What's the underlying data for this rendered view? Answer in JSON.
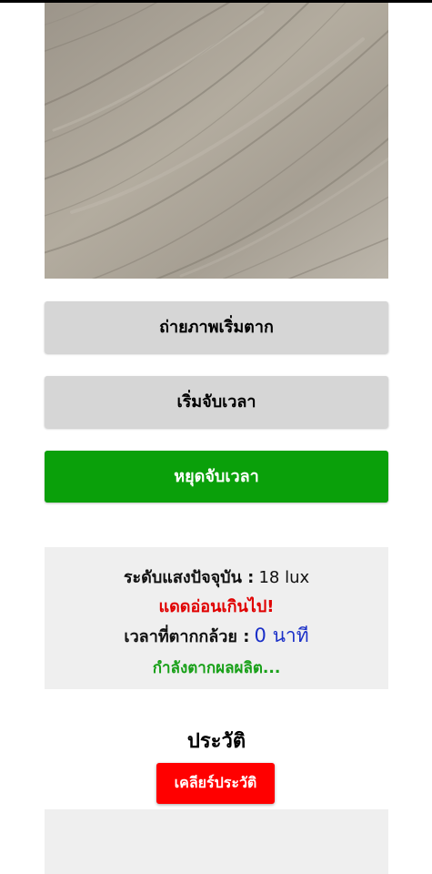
{
  "buttons": {
    "capture_label": "ถ่ายภาพเริ่มตาก",
    "start_timer_label": "เริ่มจับเวลา",
    "stop_timer_label": "หยุดจับเวลา",
    "clear_history_label": "เคลียร์ประวัติ"
  },
  "status": {
    "light_label": "ระดับแสงปัจจุบัน :",
    "light_value": "18 lux",
    "light_warning": "แดดอ่อนเกินไป!",
    "drying_time_label": "เวลาที่ตากกล้วย :",
    "drying_time_value": "0 นาที",
    "product_status": "กำลังตากผลผลิต..."
  },
  "history": {
    "title": "ประวัติ",
    "items": []
  },
  "colors": {
    "primary_green": "#0aa00a",
    "danger_red": "#ff0000",
    "warning_red": "#e00000",
    "value_blue": "#1a2fc8",
    "status_green": "#18a018",
    "button_gray": "#d6d6d6",
    "panel_gray": "#efefef"
  }
}
